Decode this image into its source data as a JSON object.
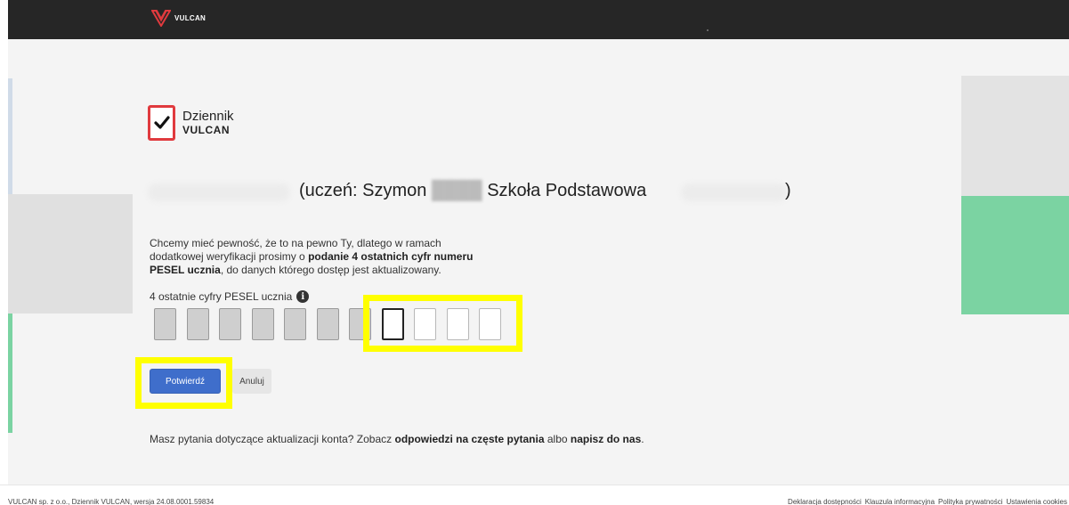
{
  "topbar": {
    "brand": "VULCAN"
  },
  "logo": {
    "line1": "Dziennik",
    "line2": "VULCAN"
  },
  "heading": {
    "text": "(uczeń: Szymon",
    "school": "Szkoła Podstawowa",
    "close_paren": ")"
  },
  "info": {
    "part1": "Chcemy mieć pewność, że to na pewno Ty, dlatego w ramach dodatkowej weryfikacji prosimy o ",
    "bold1": "podanie 4 ostatnich cyfr numeru PESEL ucznia",
    "part2": ", do danych którego dostęp jest aktualizowany."
  },
  "pesel": {
    "label": "4 ostatnie cyfry PESEL ucznia",
    "info_icon": "i",
    "total_digits": 11,
    "editable_digits": 4
  },
  "buttons": {
    "confirm": "Potwierdź",
    "cancel": "Anuluj"
  },
  "faq": {
    "prefix": "Masz pytania dotyczące aktualizacji konta? Zobacz ",
    "link1": "odpowiedzi na częste pytania",
    "middle": " albo ",
    "link2": "napisz do nas",
    "suffix": "."
  },
  "footer": {
    "left": "VULCAN sp. z o.o., Dziennik VULCAN, wersja 24.08.0001.59834",
    "links": [
      "Deklaracja dostępności",
      "Klauzula informacyjna",
      "Polityka prywatności",
      "Ustawienia cookies"
    ]
  },
  "colors": {
    "accent": "#3f6ecb",
    "brand_red": "#e03a3e",
    "highlight": "#ffff00",
    "green": "#7bd3a2"
  }
}
